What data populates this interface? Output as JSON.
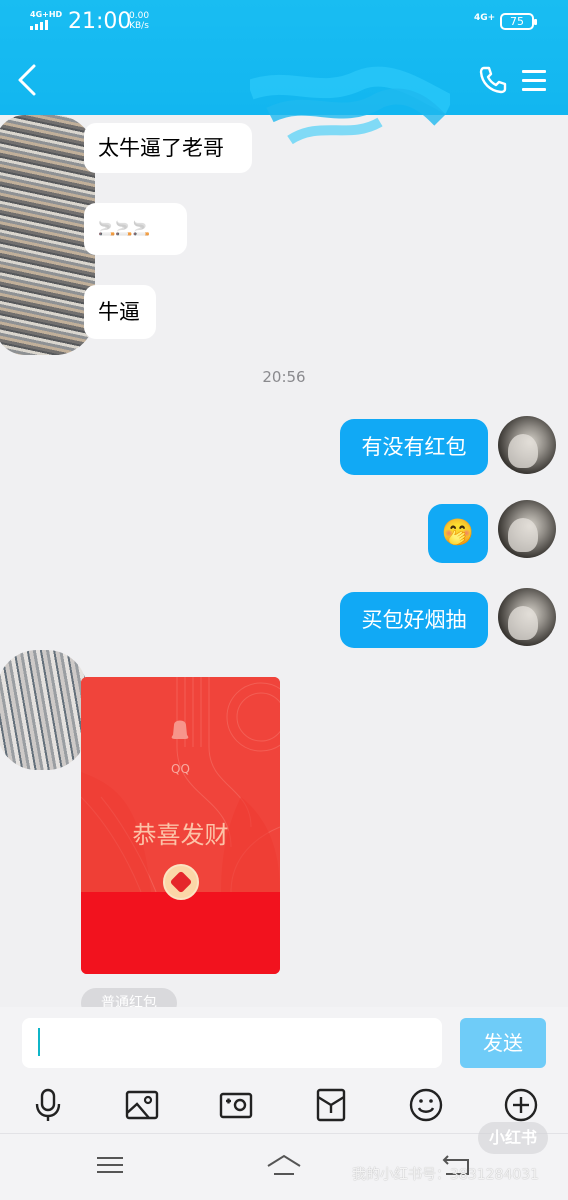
{
  "status_bar": {
    "network_left": "4G+HD",
    "time": "21:00",
    "speed_value": "0.00",
    "speed_unit": "KB/s",
    "network_right": "4G+",
    "battery": "75"
  },
  "header": {
    "back_icon": "chevron-left-icon",
    "call_icon": "phone-icon",
    "menu_icon": "menu-icon"
  },
  "messages": {
    "incoming": [
      {
        "text": "太牛逼了老哥"
      },
      {
        "text": "🚬🚬🚬"
      },
      {
        "text": "牛逼"
      }
    ],
    "timestamp": "20:56",
    "outgoing": [
      {
        "text": "有没有红包"
      },
      {
        "text": "🤭"
      },
      {
        "text": "买包好烟抽"
      }
    ],
    "red_packet": {
      "brand": "QQ",
      "title": "恭喜发财",
      "type_label": "普通红包"
    }
  },
  "composer": {
    "input_value": "",
    "send_label": "发送"
  },
  "toolbar": {
    "items": [
      "microphone-icon",
      "image-icon",
      "camera-icon",
      "red-packet-icon",
      "emoji-icon",
      "plus-icon"
    ]
  },
  "watermark": {
    "logo": "小红书",
    "text": "我的小红书号：3831284031"
  },
  "colors": {
    "header": "#15b9f1",
    "outgoing_bubble": "#11a9f5",
    "send_button": "#6fccf8",
    "red_packet": "#f23a2f"
  }
}
